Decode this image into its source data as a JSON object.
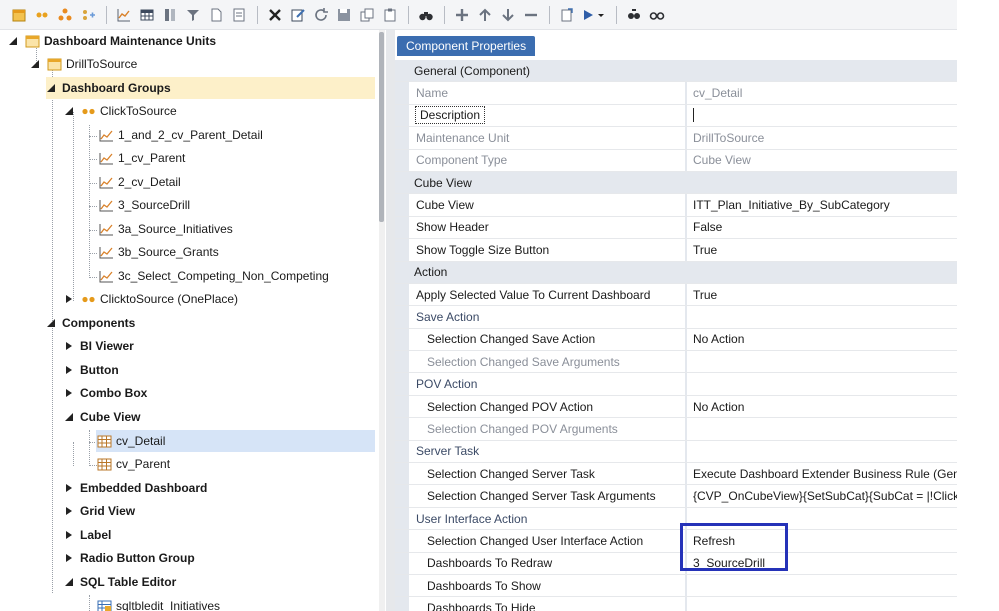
{
  "toolbar": {
    "icons": [
      "new-unit-icon",
      "new-group-icon",
      "hierarchy-icon",
      "add-members-icon",
      "chart-icon",
      "grid-icon",
      "columns-icon",
      "filter-icon",
      "document-icon",
      "page-icon",
      "delete-icon",
      "edit-icon",
      "refresh-icon",
      "save-icon",
      "copy-icon",
      "clipboard-icon",
      "binoculars-icon",
      "add-icon",
      "move-up-icon",
      "move-down-icon",
      "remove-icon",
      "export-icon",
      "run-dropdown-icon",
      "search-members-icon",
      "view-icon"
    ]
  },
  "tree": {
    "items": [
      {
        "label": "Dashboard Maintenance Units"
      },
      {
        "label": "DrillToSource"
      },
      {
        "label": "Dashboard Groups"
      },
      {
        "label": "ClickToSource"
      },
      {
        "label": "1_and_2_cv_Parent_Detail"
      },
      {
        "label": "1_cv_Parent"
      },
      {
        "label": "2_cv_Detail"
      },
      {
        "label": "3_SourceDrill"
      },
      {
        "label": "3a_Source_Initiatives"
      },
      {
        "label": "3b_Source_Grants"
      },
      {
        "label": "3c_Select_Competing_Non_Competing"
      },
      {
        "label": "ClicktoSource (OnePlace)"
      },
      {
        "label": "Components"
      },
      {
        "label": "BI Viewer"
      },
      {
        "label": "Button"
      },
      {
        "label": "Combo Box"
      },
      {
        "label": "Cube View"
      },
      {
        "label": "cv_Detail"
      },
      {
        "label": "cv_Parent"
      },
      {
        "label": "Embedded Dashboard"
      },
      {
        "label": "Grid View"
      },
      {
        "label": "Label"
      },
      {
        "label": "Radio Button Group"
      },
      {
        "label": "SQL Table Editor"
      },
      {
        "label": "sqltbledit_Initiatives"
      }
    ]
  },
  "panel": {
    "tab_label": "Component Properties",
    "rows": [
      {
        "name": "General (Component)",
        "value": ""
      },
      {
        "name": "Name",
        "value": "cv_Detail"
      },
      {
        "name": "Description",
        "value": ""
      },
      {
        "name": "Maintenance Unit",
        "value": "DrillToSource"
      },
      {
        "name": "Component Type",
        "value": "Cube View"
      },
      {
        "name": "Cube View",
        "value": ""
      },
      {
        "name": "Cube View",
        "value": "ITT_Plan_Initiative_By_SubCategory"
      },
      {
        "name": "Show Header",
        "value": "False"
      },
      {
        "name": "Show Toggle Size Button",
        "value": "True"
      },
      {
        "name": "Action",
        "value": ""
      },
      {
        "name": "Apply Selected Value To Current Dashboard",
        "value": "True"
      },
      {
        "name": "Save Action",
        "value": ""
      },
      {
        "name": "Selection Changed Save Action",
        "value": "No Action"
      },
      {
        "name": "Selection Changed Save Arguments",
        "value": ""
      },
      {
        "name": "POV Action",
        "value": ""
      },
      {
        "name": "Selection Changed POV Action",
        "value": "No Action"
      },
      {
        "name": "Selection Changed POV Arguments",
        "value": ""
      },
      {
        "name": "Server Task",
        "value": ""
      },
      {
        "name": "Selection Changed Server Task",
        "value": "Execute Dashboard Extender Business Rule (Gener"
      },
      {
        "name": "Selection Changed Server Task Arguments",
        "value": "{CVP_OnCubeView}{SetSubCat}{SubCat = |!Clicked"
      },
      {
        "name": "User Interface Action",
        "value": ""
      },
      {
        "name": "Selection Changed User Interface Action",
        "value": "Refresh"
      },
      {
        "name": "Dashboards To Redraw",
        "value": "3_SourceDrill"
      },
      {
        "name": "Dashboards To Show",
        "value": ""
      },
      {
        "name": "Dashboards To Hide",
        "value": ""
      }
    ]
  },
  "colors": {
    "tab_blue": "#3b6db0",
    "highlight_box": "#2532b8",
    "selected_group": "#fdf0c9",
    "selected_item": "#d6e4f7"
  }
}
